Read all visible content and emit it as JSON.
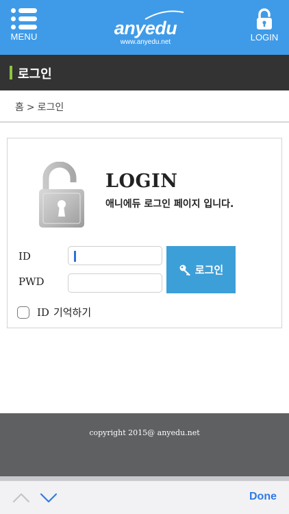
{
  "header": {
    "menu_label": "MENU",
    "logo_text": "anyedu",
    "logo_url": "www.anyedu.net",
    "login_label": "LOGIN",
    "background_color": "#3f9be8"
  },
  "section": {
    "title": "로그인",
    "accent_color": "#8cc63f"
  },
  "breadcrumb": {
    "home": "홈",
    "separator": ">",
    "current": "로그인"
  },
  "login_box": {
    "icon": "padlock-open-icon",
    "heading": "LOGIN",
    "subtitle": "애니에듀 로그인 페이지 입니다.",
    "id_label": "ID",
    "pwd_label": "PWD",
    "id_value": "",
    "pwd_value": "",
    "submit_label": "로그인",
    "submit_icon": "key-icon",
    "submit_color": "#3d9fd8",
    "remember_prefix": "ID",
    "remember_label": "기억하기",
    "remember_checked": false
  },
  "footer": {
    "copyright": "copyright 2015@ anyedu.net",
    "background_color": "#5f6062"
  },
  "keyboard_bar": {
    "prev_icon": "chevron-up-icon",
    "next_icon": "chevron-down-icon",
    "done_label": "Done",
    "done_color": "#2f7ae5"
  }
}
